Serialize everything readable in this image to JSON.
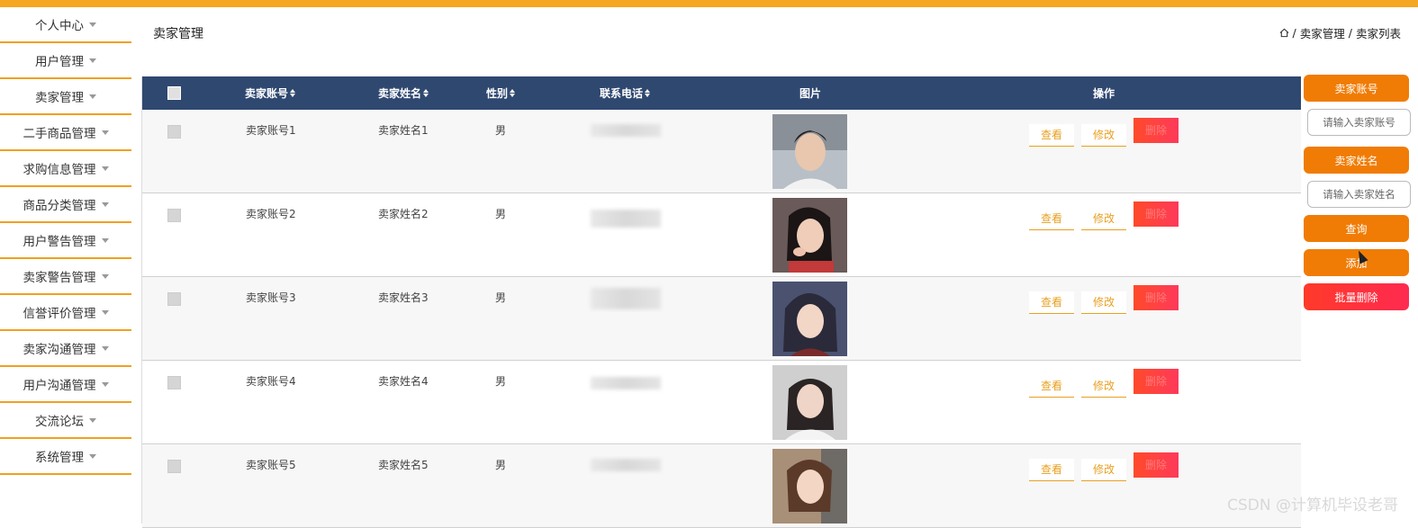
{
  "sidebar": {
    "items": [
      {
        "label": "个人中心"
      },
      {
        "label": "用户管理"
      },
      {
        "label": "卖家管理"
      },
      {
        "label": "二手商品管理"
      },
      {
        "label": "求购信息管理"
      },
      {
        "label": "商品分类管理"
      },
      {
        "label": "用户警告管理"
      },
      {
        "label": "卖家警告管理"
      },
      {
        "label": "信誉评价管理"
      },
      {
        "label": "卖家沟通管理"
      },
      {
        "label": "用户沟通管理"
      },
      {
        "label": "交流论坛"
      },
      {
        "label": "系统管理"
      }
    ]
  },
  "header": {
    "title": "卖家管理",
    "breadcrumb": [
      "卖家管理",
      "卖家列表"
    ],
    "sep": "/"
  },
  "table": {
    "columns": [
      "卖家账号",
      "卖家姓名",
      "性别",
      "联系电话",
      "图片",
      "操作"
    ],
    "rows": [
      {
        "account": "卖家账号1",
        "name": "卖家姓名1",
        "gender": "男"
      },
      {
        "account": "卖家账号2",
        "name": "卖家姓名2",
        "gender": "男"
      },
      {
        "account": "卖家账号3",
        "name": "卖家姓名3",
        "gender": "男"
      },
      {
        "account": "卖家账号4",
        "name": "卖家姓名4",
        "gender": "男"
      },
      {
        "account": "卖家账号5",
        "name": "卖家姓名5",
        "gender": "男"
      }
    ],
    "actions": {
      "view": "查看",
      "edit": "修改",
      "delete": "删除"
    }
  },
  "search": {
    "account_label": "卖家账号",
    "account_placeholder": "请输入卖家账号",
    "name_label": "卖家姓名",
    "name_placeholder": "请输入卖家姓名",
    "query": "查询",
    "add": "添加",
    "batch_delete": "批量删除"
  },
  "watermark": "CSDN @计算机毕设老哥",
  "colors": {
    "accent": "#f07c05",
    "header": "#2f4870",
    "danger": "#ff3a3a",
    "topbar": "#f5a623"
  }
}
